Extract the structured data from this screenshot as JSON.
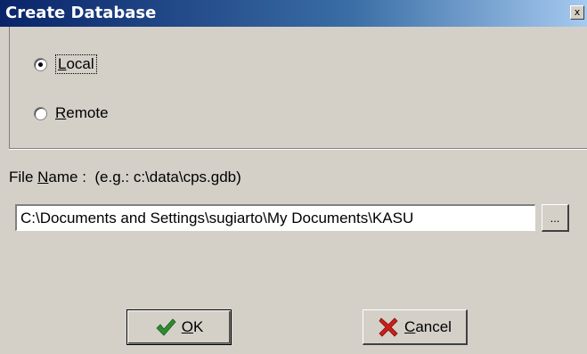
{
  "window": {
    "title": "Create Database",
    "close_label": "x"
  },
  "connection": {
    "options": [
      {
        "label_first": "L",
        "label_rest": "ocal",
        "selected": true
      },
      {
        "label_first": "R",
        "label_rest": "emote",
        "selected": false
      }
    ]
  },
  "file": {
    "label_prefix": "File ",
    "label_accel": "N",
    "label_suffix": "ame :  (e.g.: c:\\data\\cps.gdb)",
    "value": "C:\\Documents and Settings\\sugiarto\\My Documents\\KASU",
    "browse_label": "..."
  },
  "buttons": {
    "ok_accel": "O",
    "ok_rest": "K",
    "cancel_accel": "C",
    "cancel_rest": "ancel"
  },
  "icons": {
    "ok": "checkmark-icon",
    "cancel": "cross-icon",
    "ok_color": "#2e8b2e",
    "cancel_color": "#cc1f1a"
  }
}
